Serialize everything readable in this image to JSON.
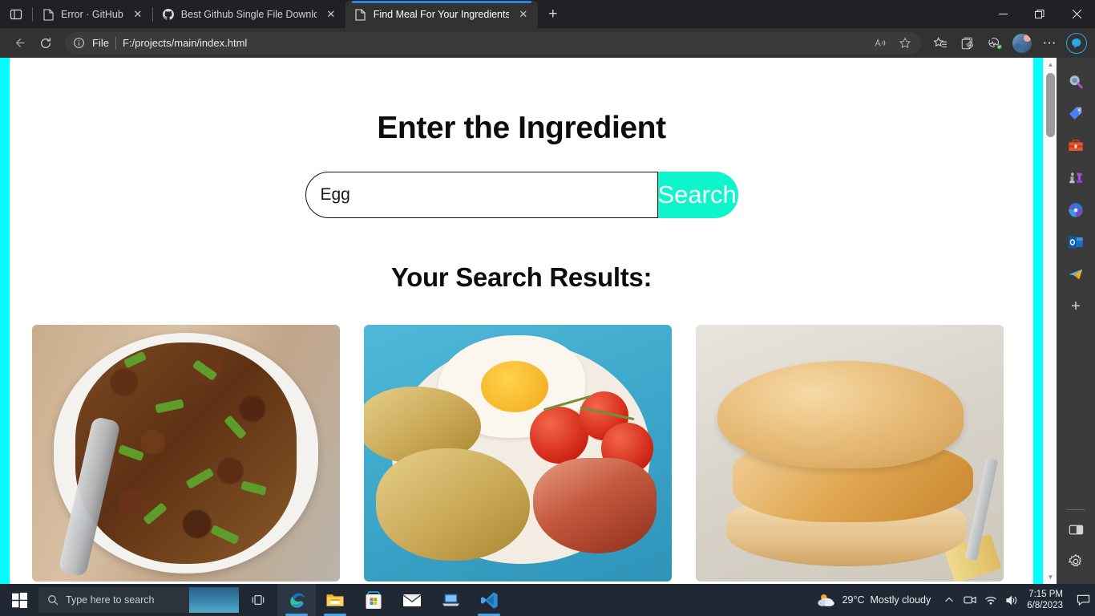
{
  "browser": {
    "tabs": [
      {
        "title": "Error · GitHub",
        "icon": "page-icon",
        "active": false
      },
      {
        "title": "Best Github Single File Download",
        "icon": "github-icon",
        "active": false
      },
      {
        "title": "Find Meal For Your Ingredients",
        "icon": "page-icon",
        "active": true
      }
    ],
    "new_tab_label": "+",
    "window_controls": {
      "minimize": "—",
      "restore": "❐",
      "close": "✕"
    },
    "toolbar": {
      "back": "←",
      "refresh": "↻",
      "scheme_label": "File",
      "url": "F:/projects/main/index.html",
      "read_aloud": "A",
      "favorite": "☆",
      "collections": "collections",
      "browser_essentials": "essentials",
      "more": "⋯"
    }
  },
  "sidebar": {
    "items": [
      {
        "name": "search",
        "label": "Search"
      },
      {
        "name": "shopping",
        "label": "Shopping"
      },
      {
        "name": "tools",
        "label": "Tools"
      },
      {
        "name": "games",
        "label": "Games"
      },
      {
        "name": "office",
        "label": "Microsoft 365"
      },
      {
        "name": "outlook",
        "label": "Outlook"
      },
      {
        "name": "drop",
        "label": "Drop"
      }
    ],
    "add_label": "+",
    "split_screen_label": "Split screen",
    "settings_label": "Settings"
  },
  "page": {
    "heading": "Enter the Ingredient",
    "search": {
      "value": "Egg",
      "placeholder": "",
      "button_label": "Search"
    },
    "results_heading": "Your Search Results:",
    "accent_color": "#0ef5cb",
    "edge_band_color": "#00ffff",
    "cards": [
      {
        "name": "beef-asparagus-stir-fry",
        "alt": "Beef and asparagus stir fry on noodles on a white oval plate"
      },
      {
        "name": "breakfast-egg-plate",
        "alt": "Fried egg, potato cakes, cherry tomatoes and bacon on a blue plate"
      },
      {
        "name": "chicken-sandwich",
        "alt": "Fried chicken sandwich with pickles on a bun"
      }
    ]
  },
  "scrollbar": {
    "up_arrow": "▲",
    "down_arrow": "▼"
  },
  "taskbar": {
    "search_placeholder": "Type here to search",
    "apps": [
      {
        "name": "edge",
        "label": "Microsoft Edge",
        "active": true,
        "running": true
      },
      {
        "name": "file-explorer",
        "label": "File Explorer",
        "active": false,
        "running": true
      },
      {
        "name": "microsoft-store",
        "label": "Microsoft Store",
        "active": false,
        "running": false
      },
      {
        "name": "mail",
        "label": "Mail",
        "active": false,
        "running": false
      },
      {
        "name": "remote-desktop",
        "label": "Remote Desktop",
        "active": false,
        "running": false
      },
      {
        "name": "vs-code",
        "label": "Visual Studio Code",
        "active": false,
        "running": true
      }
    ],
    "weather": {
      "temperature": "29°C",
      "condition": "Mostly cloudy"
    },
    "tray": {
      "chevron": "∧",
      "meet_now": "meet-now",
      "network": "network",
      "volume": "volume"
    },
    "clock": {
      "time": "7:15 PM",
      "date": "6/8/2023"
    }
  }
}
